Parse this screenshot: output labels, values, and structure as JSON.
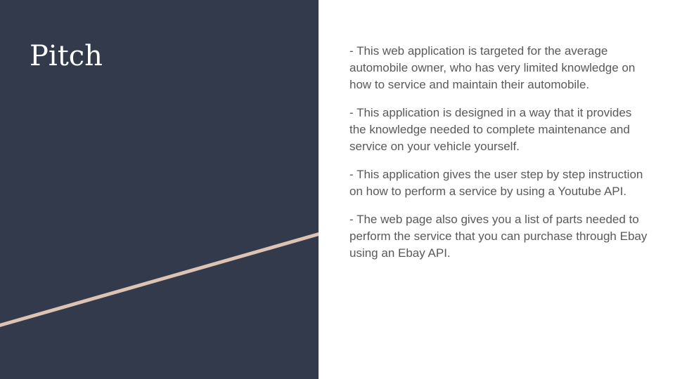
{
  "slide": {
    "title": "Pitch",
    "colors": {
      "left_panel": "#323a4c",
      "accent_line": "#dcc3b4",
      "title_text": "#ffffff",
      "body_text": "#595959"
    },
    "paragraphs": [
      "-  This web application is targeted for the average automobile owner, who has very limited knowledge on how to service and maintain their automobile.",
      "- This application is designed in a way that it provides the knowledge needed to complete maintenance and service on your vehicle yourself.",
      "- This application gives the user step by step instruction on how to perform a service by using a Youtube API.",
      "- The web page also gives you a list of parts needed to perform the service that you can purchase through Ebay using an Ebay API."
    ]
  }
}
